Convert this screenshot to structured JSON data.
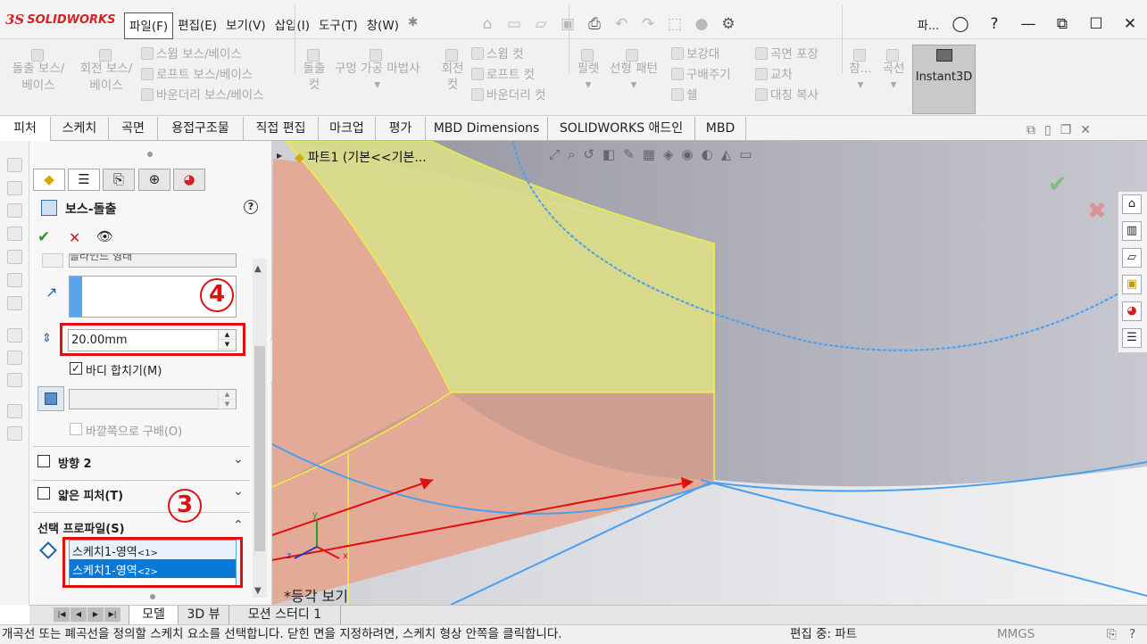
{
  "app": {
    "logo_ds": "3S",
    "logo_name": "SOLIDWORKS",
    "window_title_truncated": "파..."
  },
  "menu": {
    "items": [
      "파일(F)",
      "편집(E)",
      "보기(V)",
      "삽입(I)",
      "도구(T)",
      "창(W)"
    ],
    "pin": "📌"
  },
  "ribbon": {
    "col1": [
      "돌출 보스/",
      "베이스"
    ],
    "col2": [
      "회전 보스/",
      "베이스"
    ],
    "col3": [
      "스윕 보스/베이스",
      "로프트 보스/베이스",
      "바운더리 보스/베이스"
    ],
    "col4": [
      "돌출",
      "컷"
    ],
    "col5": [
      "구멍 가공 마법사"
    ],
    "col6": [
      "회전",
      "컷"
    ],
    "col7": [
      "스윕 컷",
      "로프트 컷",
      "바운더리 컷"
    ],
    "col8": [
      "필렛"
    ],
    "col9": [
      "선형 패턴"
    ],
    "col10": [
      "보강대",
      "구배주기",
      "쉘"
    ],
    "col11": [
      "곡면 포장",
      "교차",
      "대칭 복사"
    ],
    "col12": [
      "참..."
    ],
    "col13": [
      "곡선"
    ],
    "instant3d": "Instant3D"
  },
  "tabs": [
    "피처",
    "스케치",
    "곡면",
    "용접구조물",
    "직접 편집",
    "마크업",
    "평가",
    "MBD Dimensions",
    "SOLIDWORKS 애드인",
    "MBD"
  ],
  "pm": {
    "title": "보스-돌출",
    "help": "?",
    "ok": "✔",
    "cancel": "✕",
    "top_dropdown_partial": "블라인드 형태",
    "depth_value": "20.00mm",
    "merge_label": "바디 합치기(M)",
    "merge_checked": true,
    "draft_label": "바깥쪽으로 구배(O)",
    "dir2_label": "방향 2",
    "thin_label": "얇은 피처(T)",
    "profiles_label": "선택 프로파일(S)",
    "profiles": [
      {
        "name": "스케치1-영역",
        "tag": "<1>",
        "selected": false
      },
      {
        "name": "스케치1-영역",
        "tag": "<2>",
        "selected": true
      }
    ],
    "callout_4": "4",
    "callout_3": "3"
  },
  "viewport": {
    "tree_title": "파트1  (기본<<기본...",
    "view_label": "*등각 보기",
    "triad": {
      "x": "x",
      "y": "y",
      "z": "z"
    }
  },
  "bottom_tabs": [
    "모델",
    "3D 뷰",
    "모션 스터디 1"
  ],
  "status": {
    "message": "개곡선 또는 폐곡선을 정의할 스케치 요소를 선택합니다. 닫힌 면을 지정하려면, 스케치 형상 안쪽을 클릭합니다.",
    "mode": "편집 중: 파트",
    "units": "MMGS"
  },
  "colors": {
    "accent_red": "#e01010",
    "select_blue": "#0a78d7",
    "sketch_blue": "#4aa0f0",
    "yellow_face": "#d8dc8a",
    "salmon_face": "#e3aa98"
  }
}
